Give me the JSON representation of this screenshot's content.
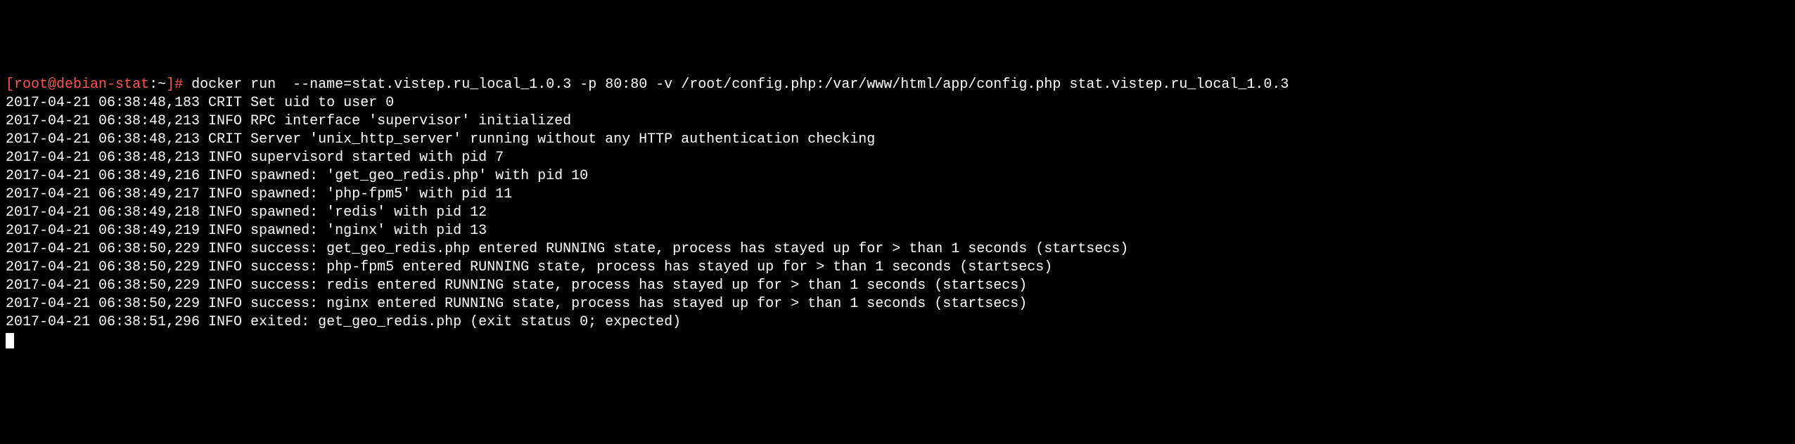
{
  "prompt": {
    "open_bracket": "[",
    "user": "root",
    "at": "@",
    "host": "debian-stat",
    "colon": ":",
    "path": "~",
    "close_bracket_hash": "]# "
  },
  "command": "docker run  --name=stat.vistep.ru_local_1.0.3 -p 80:80 -v /root/config.php:/var/www/html/app/config.php stat.vistep.ru_local_1.0.3",
  "log_lines": [
    "2017-04-21 06:38:48,183 CRIT Set uid to user 0",
    "2017-04-21 06:38:48,213 INFO RPC interface 'supervisor' initialized",
    "2017-04-21 06:38:48,213 CRIT Server 'unix_http_server' running without any HTTP authentication checking",
    "2017-04-21 06:38:48,213 INFO supervisord started with pid 7",
    "2017-04-21 06:38:49,216 INFO spawned: 'get_geo_redis.php' with pid 10",
    "2017-04-21 06:38:49,217 INFO spawned: 'php-fpm5' with pid 11",
    "2017-04-21 06:38:49,218 INFO spawned: 'redis' with pid 12",
    "2017-04-21 06:38:49,219 INFO spawned: 'nginx' with pid 13",
    "2017-04-21 06:38:50,229 INFO success: get_geo_redis.php entered RUNNING state, process has stayed up for > than 1 seconds (startsecs)",
    "2017-04-21 06:38:50,229 INFO success: php-fpm5 entered RUNNING state, process has stayed up for > than 1 seconds (startsecs)",
    "2017-04-21 06:38:50,229 INFO success: redis entered RUNNING state, process has stayed up for > than 1 seconds (startsecs)",
    "2017-04-21 06:38:50,229 INFO success: nginx entered RUNNING state, process has stayed up for > than 1 seconds (startsecs)",
    "2017-04-21 06:38:51,296 INFO exited: get_geo_redis.php (exit status 0; expected)"
  ]
}
